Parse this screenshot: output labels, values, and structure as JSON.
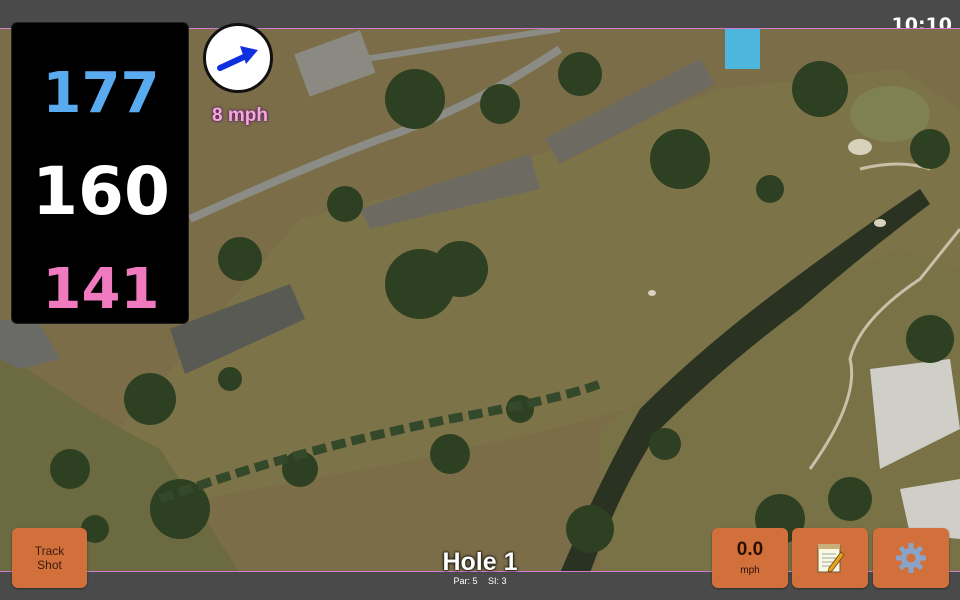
{
  "clock": "10:10",
  "distances": {
    "back": "177",
    "middle": "160",
    "front": "141"
  },
  "wind": {
    "speed": "8 mph",
    "direction_icon": "arrow-icon"
  },
  "hole": {
    "title": "Hole 1",
    "par": "Par: 5",
    "si": "SI: 3"
  },
  "buttons": {
    "track_line1": "Track",
    "track_line2": "Shot",
    "speed_value": "0.0",
    "speed_unit": "mph",
    "notes_icon": "notepad-icon",
    "settings_icon": "gear-icon"
  },
  "colors": {
    "back": "#5aaaf0",
    "middle": "#ffffff",
    "front": "#f07ac0",
    "button": "#d2703c",
    "wind_arrow": "#1030e0"
  }
}
